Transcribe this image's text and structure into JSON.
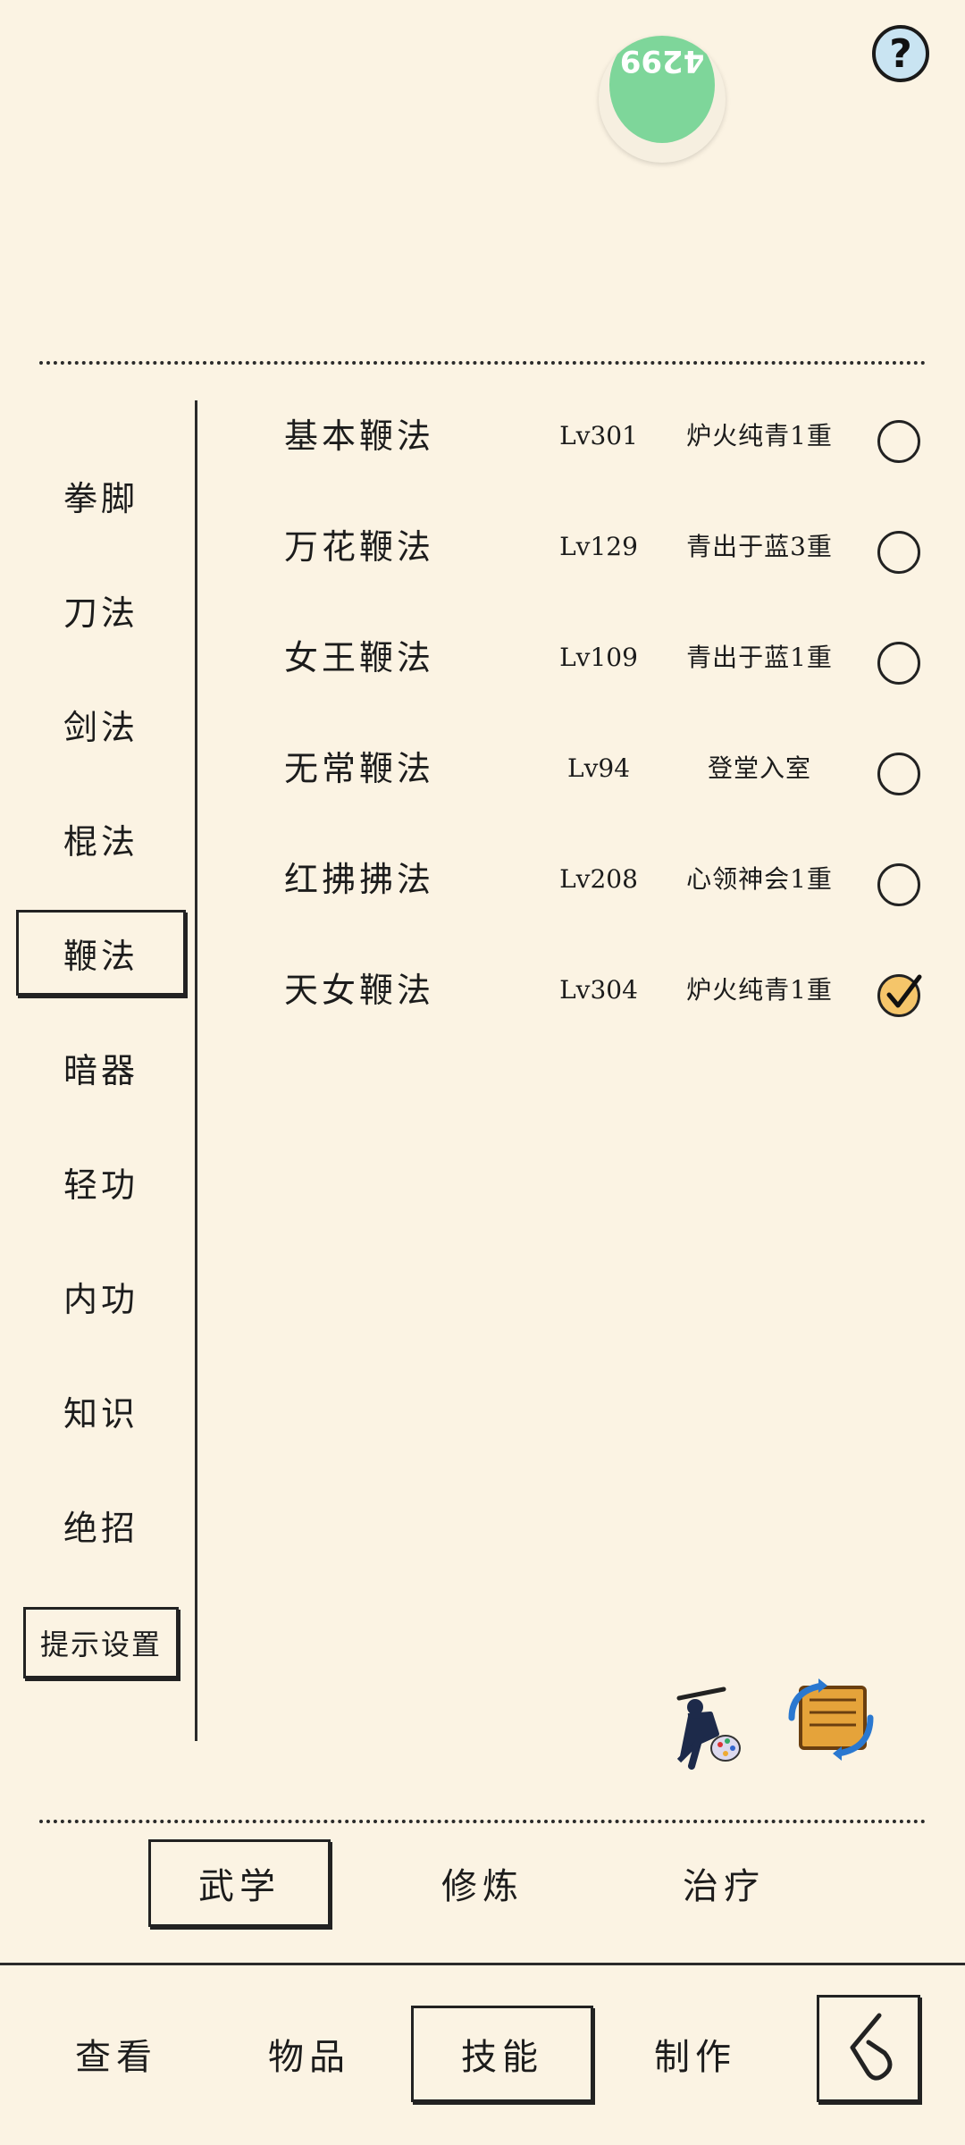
{
  "header": {
    "help_label": "?",
    "avatar_text": "4299"
  },
  "categories": [
    {
      "label": "拳脚",
      "active": false
    },
    {
      "label": "刀法",
      "active": false
    },
    {
      "label": "剑法",
      "active": false
    },
    {
      "label": "棍法",
      "active": false
    },
    {
      "label": "鞭法",
      "active": true
    },
    {
      "label": "暗器",
      "active": false
    },
    {
      "label": "轻功",
      "active": false
    },
    {
      "label": "内功",
      "active": false
    },
    {
      "label": "知识",
      "active": false
    },
    {
      "label": "绝招",
      "active": false
    }
  ],
  "hint_settings_label": "提示设置",
  "skills": [
    {
      "name": "基本鞭法",
      "level": "Lv301",
      "stage": "炉火纯青1重",
      "selected": false
    },
    {
      "name": "万花鞭法",
      "level": "Lv129",
      "stage": "青出于蓝3重",
      "selected": false
    },
    {
      "name": "女王鞭法",
      "level": "Lv109",
      "stage": "青出于蓝1重",
      "selected": false
    },
    {
      "name": "无常鞭法",
      "level": "Lv94",
      "stage": "登堂入室",
      "selected": false
    },
    {
      "name": "红拂拂法",
      "level": "Lv208",
      "stage": "心领神会1重",
      "selected": false
    },
    {
      "name": "天女鞭法",
      "level": "Lv304",
      "stage": "炉火纯青1重",
      "selected": true
    }
  ],
  "tools": {
    "left_icon": "martial-artist-palette-icon",
    "right_icon": "scroll-swap-icon"
  },
  "sub_tabs": [
    {
      "label": "武学",
      "active": true
    },
    {
      "label": "修炼",
      "active": false
    },
    {
      "label": "治疗",
      "active": false
    }
  ],
  "bottom_nav": [
    {
      "label": "查看",
      "active": false
    },
    {
      "label": "物品",
      "active": false
    },
    {
      "label": "技能",
      "active": true
    },
    {
      "label": "制作",
      "active": false
    }
  ],
  "back_icon": "back-arrow-icon"
}
